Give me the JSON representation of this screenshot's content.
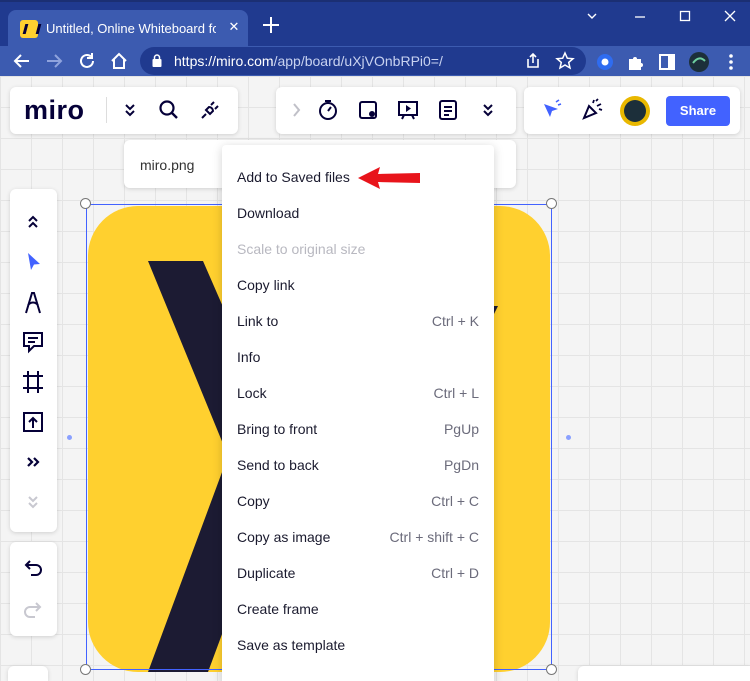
{
  "browser": {
    "tab_title": "Untitled, Online Whiteboard for Visual Collaboration",
    "tab_close": "✕",
    "url_host": "https://miro.com",
    "url_path": "/app/board/uXjVOnbRPi0=/"
  },
  "app": {
    "logo": "miro",
    "share_label": "Share",
    "accent_color": "#4262ff",
    "brand_yellow": "#ffd02f"
  },
  "board": {
    "image_filename": "miro.png"
  },
  "context_menu": {
    "items": [
      {
        "label": "Add to Saved files",
        "shortcut": "",
        "enabled": true
      },
      {
        "label": "Download",
        "shortcut": "",
        "enabled": true
      },
      {
        "label": "Scale to original size",
        "shortcut": "",
        "enabled": false
      },
      {
        "label": "Copy link",
        "shortcut": "",
        "enabled": true
      },
      {
        "label": "Link to",
        "shortcut": "Ctrl + K",
        "enabled": true
      },
      {
        "label": "Info",
        "shortcut": "",
        "enabled": true
      },
      {
        "label": "Lock",
        "shortcut": "Ctrl + L",
        "enabled": true
      },
      {
        "label": "Bring to front",
        "shortcut": "PgUp",
        "enabled": true
      },
      {
        "label": "Send to back",
        "shortcut": "PgDn",
        "enabled": true
      },
      {
        "label": "Copy",
        "shortcut": "Ctrl + C",
        "enabled": true
      },
      {
        "label": "Copy as image",
        "shortcut": "Ctrl + shift + C",
        "enabled": true
      },
      {
        "label": "Duplicate",
        "shortcut": "Ctrl + D",
        "enabled": true
      },
      {
        "label": "Create frame",
        "shortcut": "",
        "enabled": true
      },
      {
        "label": "Save as template",
        "shortcut": "",
        "enabled": true
      }
    ]
  },
  "icons": {
    "left_toolbar": [
      "collapse-up-icon",
      "select-cursor-icon",
      "pen-icon",
      "comment-icon",
      "frame-icon",
      "upload-icon",
      "more-tools-icon",
      "expand-down-icon",
      "undo-icon",
      "redo-icon"
    ],
    "top_toolbar": [
      "chevron-down-icon",
      "search-icon",
      "plug-icon",
      "timer-icon",
      "card-icon",
      "presentation-icon",
      "notes-icon",
      "more-icon",
      "cursor-select-icon",
      "celebrate-icon"
    ]
  }
}
